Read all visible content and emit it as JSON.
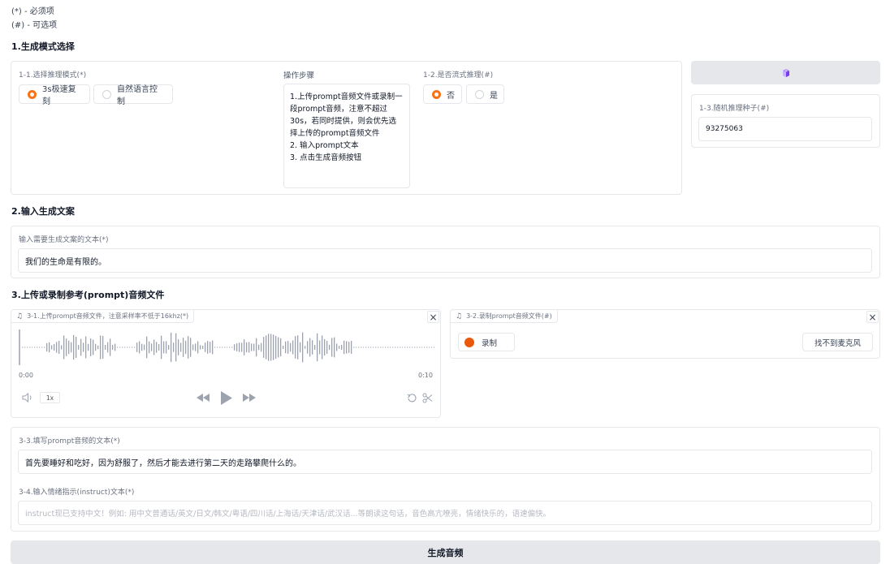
{
  "legend": {
    "required": "(*) - 必须项",
    "optional": "(#) - 可选项"
  },
  "section1": {
    "title": "1.生成模式选择",
    "mode_label": "1-1.选择推理模式(*)",
    "mode_options": [
      "3s极速复刻",
      "自然语言控制"
    ],
    "mode_selected": "3s极速复刻",
    "steps_label": "操作步骤",
    "steps_text": "1.上传prompt音频文件或录制一段prompt音频，注意不超过30s，若同时提供，则会优先选择上传的prompt音频文件\n2. 输入prompt文本\n3. 点击生成音频按钮",
    "stream_label": "1-2.是否流式推理(#)",
    "stream_options": [
      "否",
      "是"
    ],
    "stream_selected": "否",
    "dice_icon": "dice-icon",
    "seed_label": "1-3.随机推理种子(#)",
    "seed_value": "93275063"
  },
  "section2": {
    "title": "2.输入生成文案",
    "tts_label": "输入需要生成文案的文本(*)",
    "tts_value": "我们的生命是有限的。"
  },
  "section3": {
    "title": "3.上传或录制参考(prompt)音频文件",
    "upload_label": "3-1.上传prompt音频文件，注意采样率不低于16khz(*)",
    "time_start": "0:00",
    "time_end": "0:10",
    "speed": "1x",
    "record_label": "3-2.录制prompt音频文件(#)",
    "record_button": "录制",
    "mic_button": "找不到麦克风",
    "close_glyph": "×",
    "prompt_text_label": "3-3.填写prompt音频的文本(*)",
    "prompt_text_value": "首先要睡好和吃好，因为舒服了，然后才能去进行第二天的走路攀爬什么的。",
    "instruct_label": "3-4.输入情绪指示(instruct)文本(*)",
    "instruct_placeholder": "instruct现已支持中文！例如: 用中文普通话/英文/日文/韩文/粤语/四川话/上海话/天津话/武汉话...等朗读这句话，音色高亢嘹亮，情绪快乐的，语速偏快。"
  },
  "generate_button": "生成音频",
  "colors": {
    "accent": "#f97316",
    "record_dot": "#ea580c",
    "button_gray": "#e5e7eb",
    "border": "#e5e7eb"
  },
  "icons": [
    "music-note-icon",
    "close-icon",
    "volume-icon",
    "rewind-icon",
    "play-icon",
    "fast-forward-icon",
    "reset-icon",
    "scissors-icon",
    "dice-icon",
    "record-dot-icon"
  ]
}
